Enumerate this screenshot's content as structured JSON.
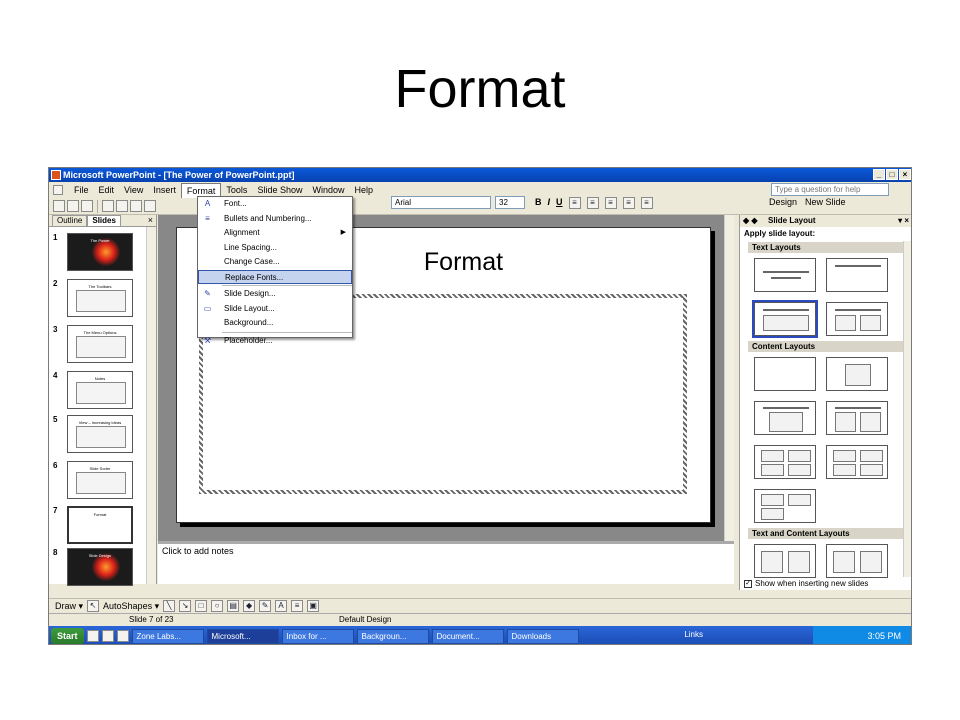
{
  "heading": "Format",
  "window": {
    "title": "Microsoft PowerPoint - [The Power of PowerPoint.ppt]"
  },
  "menubar": [
    "File",
    "Edit",
    "View",
    "Insert",
    "Format",
    "Tools",
    "Slide Show",
    "Window",
    "Help"
  ],
  "help_placeholder": "Type a question for help",
  "toolbar": {
    "font": "Arial",
    "size": "32",
    "bold": "B",
    "italic": "I",
    "underline": "U",
    "design": "Design",
    "new_slide": "New Slide"
  },
  "left_pane": {
    "tabs": [
      "Outline",
      "Slides"
    ]
  },
  "slides": [
    {
      "num": "1",
      "title": "The Power"
    },
    {
      "num": "2",
      "title": "The Toolbars"
    },
    {
      "num": "3",
      "title": "The Menu Options"
    },
    {
      "num": "4",
      "title": "Notes"
    },
    {
      "num": "5",
      "title": "View – Increasing Ideas"
    },
    {
      "num": "6",
      "title": "Slide Sorter"
    },
    {
      "num": "7",
      "title": "Format"
    },
    {
      "num": "8",
      "title": "Slide Design"
    }
  ],
  "slide_title": "Format",
  "notes_placeholder": "Click to add notes",
  "format_menu": {
    "items": [
      {
        "label": "Font...",
        "icon": "A"
      },
      {
        "label": "Bullets and Numbering...",
        "icon": "≡"
      },
      {
        "label": "Alignment",
        "icon": ""
      },
      {
        "label": "Line Spacing...",
        "icon": ""
      },
      {
        "label": "Change Case...",
        "icon": ""
      },
      {
        "label": "Replace Fonts...",
        "icon": ""
      },
      {
        "label": "Slide Design...",
        "icon": "✎"
      },
      {
        "label": "Slide Layout...",
        "icon": "▭"
      },
      {
        "label": "Background...",
        "icon": ""
      },
      {
        "label": "Placeholder...",
        "icon": "⚒"
      }
    ],
    "highlighted": "Replace Fonts..."
  },
  "task_pane": {
    "title": "Slide Layout",
    "subtitle": "Apply slide layout:",
    "sections": [
      "Text Layouts",
      "Content Layouts",
      "Text and Content Layouts"
    ],
    "show_checkbox": "Show when inserting new slides"
  },
  "draw_toolbar": {
    "draw": "Draw ▾",
    "autoshapes": "AutoShapes ▾"
  },
  "status": {
    "slide": "Slide 7 of 23",
    "design": "Default Design"
  },
  "taskbar": {
    "start": "Start",
    "items": [
      "Zone Labs...",
      "Microsoft...",
      "Inbox for ...",
      "Backgroun...",
      "Document...",
      "Downloads"
    ],
    "links": "Links",
    "clock": "3:05 PM"
  },
  "colors": {
    "titlebar": "#0a58d8",
    "taskbar": "#2a66d8",
    "menu_highlight": "#c6d3ef"
  }
}
